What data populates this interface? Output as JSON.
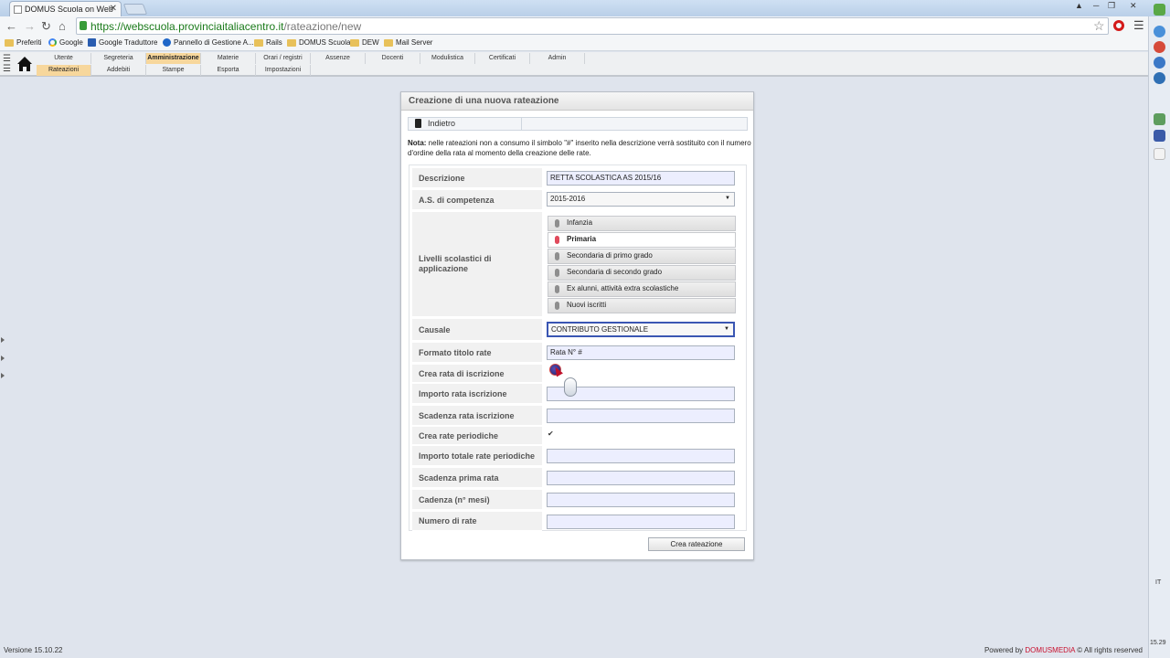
{
  "browser": {
    "tab_title": "DOMUS Scuola on Web",
    "tab_close": "✕",
    "url_scheme": "https://",
    "url_host": "webscuola.provinciaitaliacentro.it",
    "url_path": "/rateazione/new",
    "bookmarks": [
      {
        "label": "Preferiti",
        "icon": "folder-icon"
      },
      {
        "label": "Google",
        "icon": "google-icon"
      },
      {
        "label": "Google Traduttore",
        "icon": "translate-icon"
      },
      {
        "label": "Pannello di Gestione A...",
        "icon": "panel-icon"
      },
      {
        "label": "Rails",
        "icon": "folder-icon"
      },
      {
        "label": "DOMUS Scuola",
        "icon": "folder-icon"
      },
      {
        "label": "DEW",
        "icon": "folder-icon"
      },
      {
        "label": "Mail Server",
        "icon": "folder-icon"
      }
    ]
  },
  "appmenu": {
    "top": [
      "Utente",
      "Segreteria",
      "Amministrazione",
      "Materie",
      "Orari / registri",
      "Assenze",
      "Docenti",
      "Modulistica",
      "Certificati",
      "Admin"
    ],
    "sub": [
      "Rateazioni",
      "Addebiti",
      "Stampe",
      "Esporta",
      "Impostazioni"
    ]
  },
  "panel": {
    "title": "Creazione di una nuova rateazione",
    "back_label": "Indietro",
    "note_bold": "Nota:",
    "note_text": " nelle rateazioni non a consumo il simbolo \"#\" inserito nella descrizione verrà sostituito con il numero d'ordine della rata al momento della creazione delle rate.",
    "fields": {
      "descrizione_label": "Descrizione",
      "descrizione_value": "RETTA SCOLASTICA AS 2015/16",
      "as_label": "A.S. di competenza",
      "as_value": "2015-2016",
      "livelli_label": "Livelli scolastici di applicazione",
      "levels": [
        {
          "label": "Infanzia",
          "selected": false
        },
        {
          "label": "Primaria",
          "selected": true
        },
        {
          "label": "Secondaria di primo grado",
          "selected": false
        },
        {
          "label": "Secondaria di secondo grado",
          "selected": false
        },
        {
          "label": "Ex alunni, attività extra scolastiche",
          "selected": false
        },
        {
          "label": "Nuovi iscritti",
          "selected": false
        }
      ],
      "causale_label": "Causale",
      "causale_value": "CONTRIBUTO GESTIONALE",
      "formato_label": "Formato titolo rate",
      "formato_value": "Rata N° #",
      "crea_iscrizione_label": "Crea rata di iscrizione",
      "importo_iscrizione_label": "Importo rata iscrizione",
      "importo_iscrizione_value": "",
      "scadenza_iscrizione_label": "Scadenza rata iscrizione",
      "scadenza_iscrizione_value": "",
      "crea_periodiche_label": "Crea rate periodiche",
      "crea_periodiche_checked": true,
      "crea_periodiche_mark": "✔",
      "importo_totale_label": "Importo totale rate periodiche",
      "importo_totale_value": "",
      "scadenza_prima_label": "Scadenza prima rata",
      "scadenza_prima_value": "",
      "cadenza_label": "Cadenza (n° mesi)",
      "cadenza_value": "",
      "numero_label": "Numero di rate",
      "numero_value": ""
    },
    "submit_label": "Crea rateazione"
  },
  "footer": {
    "version": "Versione 15.10.22",
    "powered_prefix": "Powered by ",
    "brand": "DOMUSMEDIA",
    "powered_suffix": " © All rights reserved"
  },
  "system": {
    "lang": "IT",
    "clock": "15.29"
  },
  "colors": {
    "active_menu": "#f7d79c",
    "brand_red": "#c8102e",
    "selected_pin": "#e04a5c"
  }
}
